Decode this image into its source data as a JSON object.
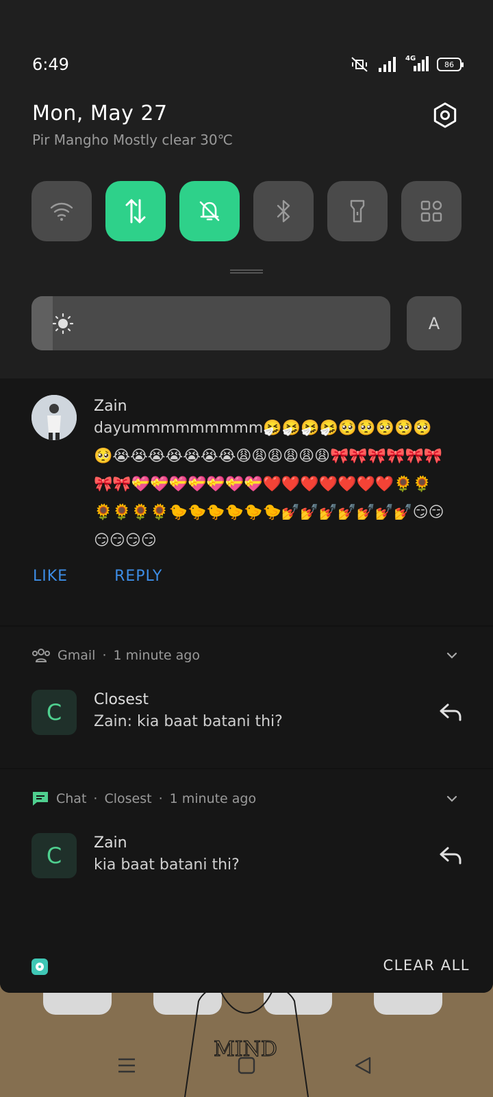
{
  "status_bar": {
    "time": "6:49",
    "network": "4G",
    "battery": "86",
    "icons": [
      "vibrate-muted-icon",
      "signal-icon",
      "signal-4g-icon",
      "battery-icon"
    ]
  },
  "header": {
    "date": "Mon, May 27",
    "weather": "Pir Mangho Mostly clear 30℃",
    "settings_icon": "gear-icon"
  },
  "quick_tiles": [
    {
      "name": "wifi",
      "icon": "wifi-icon",
      "on": false
    },
    {
      "name": "mobile-data",
      "icon": "data-arrows-icon",
      "on": true
    },
    {
      "name": "silent",
      "icon": "bell-off-icon",
      "on": true
    },
    {
      "name": "bluetooth",
      "icon": "bluetooth-icon",
      "on": false
    },
    {
      "name": "flashlight",
      "icon": "flashlight-icon",
      "on": false
    },
    {
      "name": "more",
      "icon": "grid-icon",
      "on": false
    }
  ],
  "brightness": {
    "level": 0.06,
    "auto_label": "A"
  },
  "notification_1": {
    "sender": "Zain",
    "message": "dayummmmmmmmm🤧🤧🤧🤧🥺🥺🥺🥺🥺🥺😭😭😭😭😭😭😭😩😩😩😩😩😩🎀🎀🎀🎀🎀🎀🎀🎀💝💝💝💝💝💝💝❤️❤️❤️❤️❤️❤️❤️🌻🌻🌻🌻🌻🌻🐤🐤🐤🐤🐤🐤💅💅💅💅💅💅💅😏😏😏😏😏😏",
    "like_label": "LIKE",
    "reply_label": "REPLY"
  },
  "notification_2": {
    "app": "Gmail",
    "time": "1 minute ago",
    "avatar_letter": "C",
    "title": "Closest",
    "body": "Zain: kia baat batani thi?"
  },
  "notification_3": {
    "app": "Chat",
    "group": "Closest",
    "time": "1 minute ago",
    "avatar_letter": "C",
    "title": "Zain",
    "body": "kia baat batani thi?"
  },
  "footer": {
    "clear_all": "CLEAR ALL"
  },
  "wallpaper": {
    "sketch_text": "MIND"
  },
  "colors": {
    "accent_green": "#2ed18a",
    "link_blue": "#3d8de6",
    "chat_green": "#4fcf8f"
  }
}
